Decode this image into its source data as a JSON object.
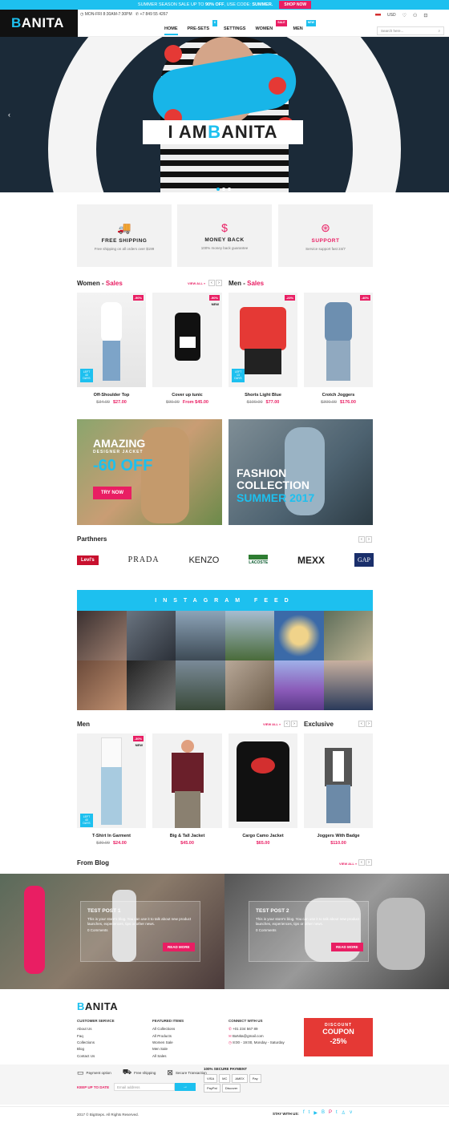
{
  "promo": {
    "text_before": "SUMMER SEASON SALE UP TO ",
    "text_percent": "90% OFF",
    "text_after": ", USE CODE: ",
    "code": "SUMMER.",
    "button": "SHOP NOW"
  },
  "header": {
    "logo_first": "B",
    "logo_rest": "ANITA",
    "hours": "MON-FRI 8:30AM-7:30PM",
    "phone": "+7 849 55 4267",
    "currency": "USD",
    "search_placeholder": "Search here..."
  },
  "nav": {
    "items": [
      {
        "label": "HOME",
        "tag": ""
      },
      {
        "label": "PRE-SETS",
        "tag": "6"
      },
      {
        "label": "SETTINGS",
        "tag": ""
      },
      {
        "label": "WOMEN",
        "tag": "SALE"
      },
      {
        "label": "MEN",
        "tag": "NEW"
      }
    ]
  },
  "hero": {
    "title_a": "I AM ",
    "title_b": "B",
    "title_c": "ANITA"
  },
  "features": [
    {
      "icon": "truck-icon",
      "glyph": "🚚",
      "title": "FREE SHIPPING",
      "sub": "Free shipping on all orders over $199",
      "pink": false
    },
    {
      "icon": "dollar-icon",
      "glyph": "$",
      "title": "MONEY BACK",
      "sub": "100% money back guarantee",
      "pink": false
    },
    {
      "icon": "lifebuoy-icon",
      "glyph": "⊛",
      "title": "SUPPORT",
      "sub": "Service support fast 24/7",
      "pink": true
    }
  ],
  "women_sales": {
    "title": "Women",
    "dash": " - ",
    "pink": "Sales",
    "view_all": "VIEW ALL »"
  },
  "men_sales": {
    "title": "Men",
    "dash": " - ",
    "pink": "Sales"
  },
  "sale_products": [
    {
      "name": "Off-Shoulder Top",
      "old": "$34.00",
      "new": "$27.00",
      "badge": "-90%",
      "badge_new": "",
      "left": "LEFT 40 DAYS"
    },
    {
      "name": "Cover up tunic",
      "old": "$90.00",
      "new": "From $45.00",
      "badge": "-90%",
      "badge_new": "NEW",
      "left": ""
    },
    {
      "name": "Shorts Light Blue",
      "old": "$100.00",
      "new": "$77.00",
      "badge": "-23%",
      "badge_new": "",
      "left": "LEFT 13 DAYS"
    },
    {
      "name": "Crotch Joggers",
      "old": "$300.00",
      "new": "$176.00",
      "badge": "-40%",
      "badge_new": "",
      "left": ""
    }
  ],
  "banner1": {
    "line1": "AMAZING",
    "line2": "DESIGNER JACKET",
    "line3": "-60 OFF",
    "button": "TRY NOW"
  },
  "banner2": {
    "line1": "FASHION",
    "line2": "COLLECTION",
    "line3": "SUMMER 2017"
  },
  "partners": {
    "title": "Parthners",
    "brands": [
      "Levi's",
      "PRADA",
      "KENZO",
      "LACOSTE",
      "MEXX",
      "GAP"
    ]
  },
  "instagram": {
    "title": "INSTAGRAM FEED"
  },
  "men": {
    "title": "Men",
    "view_all": "VIEW ALL »",
    "products": [
      {
        "name": "T-Shirt In Garment",
        "old": "$30.00",
        "new": "$24.00",
        "badge": "-30%",
        "badge_new": "NEW",
        "left": "LEFT 40 DAYS"
      },
      {
        "name": "Big & Tall Jacket",
        "old": "",
        "new": "$45.00",
        "badge": "",
        "badge_new": "",
        "left": ""
      },
      {
        "name": "Cargo Camo Jacket",
        "old": "",
        "new": "$65.00",
        "badge": "",
        "badge_new": "",
        "left": ""
      }
    ]
  },
  "exclusive": {
    "title": "Exclusive",
    "product": {
      "name": "Joggers With Badge",
      "new": "$110.00"
    }
  },
  "blog": {
    "title": "From Blog",
    "view_all": "VIEW ALL »",
    "posts": [
      {
        "title": "TEST POST 1",
        "text": "This is your store's blog. You can use it to talk about new product launches, experiences, tips or other news.",
        "comments": "0 Comments",
        "button": "READ MORE"
      },
      {
        "title": "TEST POST 2",
        "text": "This is your store's blog. You can use it to talk about new product launches, experiences, tips or other news.",
        "comments": "0 Comments",
        "button": "READ MORE"
      }
    ]
  },
  "footer": {
    "logo_first": "B",
    "logo_rest": "ANITA",
    "customer_service": {
      "title": "CUSTOMER SERVICE",
      "links": [
        "About Us",
        "Faq",
        "Collections",
        "Blog",
        "Contact Us"
      ]
    },
    "featured": {
      "title": "FEATURED ITEMS",
      "links": [
        "All Collections",
        "All Products",
        "Women Sale",
        "Men Sale",
        "All Sales"
      ]
    },
    "connect": {
      "title": "CONNECT WITH US",
      "phone": "+01 234 567 89",
      "email": "BaNita@gmail.com",
      "hours": "8:00 - 19:00, Monday - Saturday"
    },
    "coupon": {
      "line1": "DISCOUNT",
      "line2": "COUPON",
      "line3": "-25%"
    },
    "perks": [
      "Payment option",
      "Free shipping",
      "Secure Transaction"
    ],
    "secure_title": "100% SECURE PAYMENT",
    "payments": [
      "VISA",
      "MC",
      "AMEX",
      "Pay",
      "PayPal",
      "Discover"
    ],
    "newsletter_label": "KEEP UP TO DATE",
    "email_placeholder": "Email address",
    "copyright": "2017 © BigSteps. All Rights Reserved.",
    "stay_label": "STAY WITH US:"
  },
  "colors": {
    "accent": "#1dc0ef",
    "pink": "#e91e63",
    "dark": "#111111",
    "coupon": "#e53935"
  }
}
